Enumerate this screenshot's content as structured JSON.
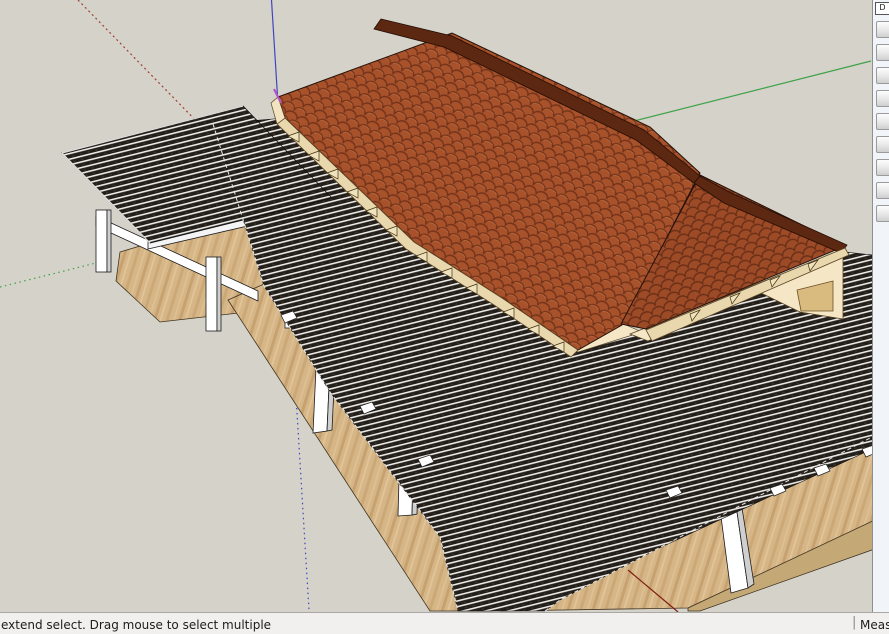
{
  "status_bar": {
    "message": "extend select. Drag mouse to select multiple",
    "separator": "|",
    "measurements_label": "Meas"
  },
  "side_panel": {
    "header_text": "D",
    "button_count": 9
  },
  "axes": {
    "red_axis_color": "#9e4238",
    "red_axis_solid_color": "#7e1d10",
    "green_axis_color": "#3fa24a",
    "blue_axis_color": "#3f45c0",
    "selected_vertex_color": "#b052c8"
  },
  "colors": {
    "bg": "#d5d2c9",
    "tile_roof": "#a8522b",
    "tile_shadow": "#73331a",
    "ridge_dark": "#5d2811",
    "fascia_cream": "#e9d7ae",
    "wall_cream": "#f5e7c6",
    "opening_tan": "#d9ba7f",
    "louver_dark": "#221e1a",
    "louver_light": "#eceae6",
    "deck_wood": "#d6b586",
    "deck_edge_wood": "#c4a876",
    "post_white": "#ffffff",
    "panel_bg": "#f1f4f8",
    "status_bg": "#f1f0ee"
  }
}
